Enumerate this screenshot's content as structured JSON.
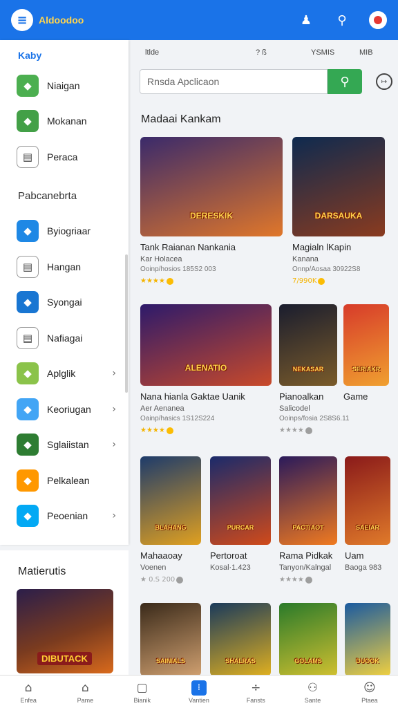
{
  "header": {
    "logo_glyph": "≡",
    "brand": "Aldoodoo",
    "icons": [
      "person-icon",
      "search-icon",
      "avatar-icon"
    ]
  },
  "sidebar": {
    "section_title": "Kaby",
    "items_top": [
      {
        "label": "Niaigan",
        "icon": "game-character-icon",
        "color": "#4caf50"
      },
      {
        "label": "Mokanan",
        "icon": "folder-icon",
        "color": "#43a047"
      },
      {
        "label": "Peraca",
        "icon": "document-icon",
        "color": "#ffffff"
      }
    ],
    "group_title": "Pabcanebrta",
    "items": [
      {
        "label": "Byiogriaar",
        "icon": "game-avatar-icon",
        "color": "#1e88e5",
        "chevron": false
      },
      {
        "label": "Hangan",
        "icon": "window-icon",
        "color": "#ffffff",
        "chevron": false
      },
      {
        "label": "Syongai",
        "icon": "character-icon",
        "color": "#1976d2",
        "chevron": false
      },
      {
        "label": "Nafiagai",
        "icon": "calendar-icon",
        "color": "#ffffff",
        "chevron": false
      },
      {
        "label": "Aplglik",
        "icon": "character-green-icon",
        "color": "#8bc34a",
        "chevron": true
      },
      {
        "label": "Keoriugan",
        "icon": "blue-app-icon",
        "color": "#42a5f5",
        "chevron": true
      },
      {
        "label": "Sglaiistan",
        "icon": "character-green-icon",
        "color": "#2e7d32",
        "chevron": true
      },
      {
        "label": "Pelkalean",
        "icon": "orange-app-icon",
        "color": "#ff9800",
        "chevron": false
      },
      {
        "label": "Peoenian",
        "icon": "pen-icon",
        "color": "#03a9f4",
        "chevron": true
      }
    ],
    "bottom_title": "Matierutis",
    "bottom_art_label": "DIBUTACK"
  },
  "main": {
    "strip": {
      "left": "ltlde",
      "mid": "? ß",
      "right1": "YSMIS",
      "right2": "MIB"
    },
    "search_placeholder": "Rnsda Apclicaon",
    "section_title": "Madaai Kankam",
    "cards": [
      {
        "title": "Tank Raianan Nankania",
        "dev": "Kar Holacea",
        "meta": "Ooinp/hosios 185S2 003",
        "stars": "★★★★",
        "star_style": "gold",
        "thumb_title": "DERESKIK",
        "g1": "#3a2a6b",
        "g2": "#e0772a"
      },
      {
        "title": "Magialn lKapin",
        "dev": "Kanana",
        "meta": "Onnp/Aosaa 30922S8",
        "stars": "7/990K",
        "star_style": "gold",
        "thumb_title": "DARSAUKA",
        "g1": "#0e2a4f",
        "g2": "#8a3b1f"
      },
      {
        "title": "Nana hianla Gaktae Uanik",
        "dev": "Aer Aenanea",
        "meta": "Oainp/hasics 1S12S224",
        "stars": "★★★★",
        "star_style": "gold",
        "thumb_title": "ALENATIO",
        "g1": "#2d1a6b",
        "g2": "#c94a2a"
      },
      {
        "title": "Pianoalkan",
        "dev": "Salicodel",
        "meta": "Ooinps/fosia 2S8S6.11",
        "stars": "★★★★",
        "star_style": "grey",
        "thumb_title": "NEKASAR",
        "g1": "#1a1d2e",
        "g2": "#7a5b2a"
      },
      {
        "title": "Game",
        "dev": "",
        "meta": "",
        "stars": "",
        "star_style": "none",
        "thumb_title": "SERIAKR",
        "g1": "#d73b2a",
        "g2": "#f0a030"
      },
      {
        "title": "Mahaaoay",
        "dev": "Voenen",
        "meta": "",
        "stars": "★ 0.S 200",
        "star_style": "grey",
        "thumb_title": "BLAHANG",
        "g1": "#1d3b6b",
        "g2": "#e0a020"
      },
      {
        "title": "Pertoroat",
        "dev": "Kosal·1.423",
        "meta": "",
        "stars": "",
        "star_style": "none",
        "thumb_title": "PURCAR",
        "g1": "#1a2a6b",
        "g2": "#d04a1a"
      },
      {
        "title": "Rama Pidkak",
        "dev": "Tanyon/Kalngal",
        "meta": "",
        "stars": "★★★★",
        "star_style": "grey",
        "thumb_title": "PACTIAOT",
        "g1": "#2a1a5b",
        "g2": "#f07a20"
      },
      {
        "title": "Uam",
        "dev": "Baoga 983",
        "meta": "",
        "stars": "",
        "star_style": "none",
        "thumb_title": "SAEIAR",
        "g1": "#8a1a1a",
        "g2": "#e07a2a"
      },
      {
        "title": "",
        "dev": "",
        "meta": "",
        "stars": "",
        "star_style": "none",
        "thumb_title": "SAINIALS",
        "g1": "#3a2a1a",
        "g2": "#d0a070"
      },
      {
        "title": "",
        "dev": "",
        "meta": "",
        "stars": "",
        "star_style": "none",
        "thumb_title": "SHALRAS",
        "g1": "#1a3a5b",
        "g2": "#e0b020"
      },
      {
        "title": "",
        "dev": "",
        "meta": "",
        "stars": "",
        "star_style": "none",
        "thumb_title": "GOLAMS",
        "g1": "#2a7a2a",
        "g2": "#d0c030"
      },
      {
        "title": "",
        "dev": "",
        "meta": "",
        "stars": "",
        "star_style": "none",
        "thumb_title": "DUOOK",
        "g1": "#1a5aa0",
        "g2": "#f0d040"
      }
    ]
  },
  "bottom_nav": [
    {
      "label": "Enfea",
      "icon": "home-alert-icon",
      "glyph": "⌂",
      "active": false
    },
    {
      "label": "Pame",
      "icon": "home-icon",
      "glyph": "⌂",
      "active": false
    },
    {
      "label": "Bianik",
      "icon": "app-icon",
      "glyph": "▢",
      "active": false
    },
    {
      "label": "Vantien",
      "icon": "apps-icon",
      "glyph": "⁞",
      "active": true
    },
    {
      "label": "Fansts",
      "icon": "divide-icon",
      "glyph": "÷",
      "active": false
    },
    {
      "label": "Sante",
      "icon": "profile-icon",
      "glyph": "⚇",
      "active": false
    },
    {
      "label": "Ptaea",
      "icon": "face-icon",
      "glyph": "☺",
      "active": false
    }
  ]
}
